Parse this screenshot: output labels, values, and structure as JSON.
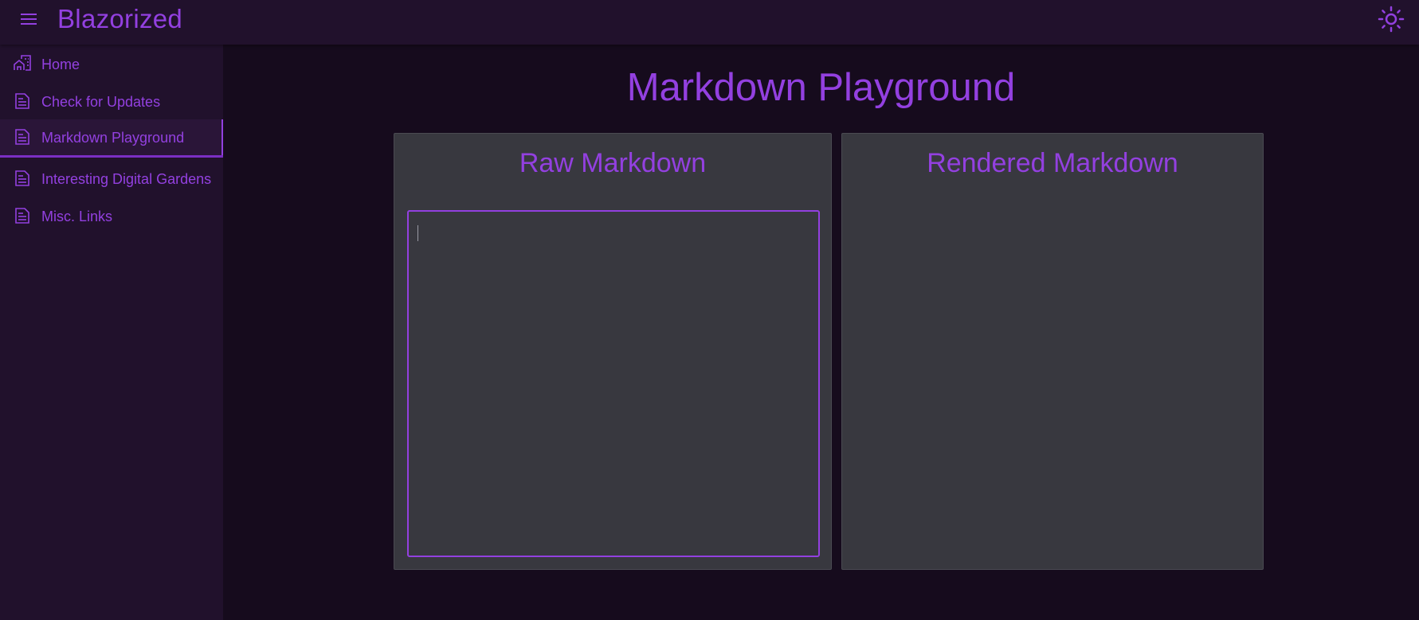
{
  "appbar": {
    "title": "Blazorized",
    "menu_icon": "hamburger-menu-icon",
    "theme_icon": "sun-icon"
  },
  "sidebar": {
    "items": [
      {
        "label": "Home",
        "icon": "home-icon",
        "active": false
      },
      {
        "label": "Check for Updates",
        "icon": "document-icon",
        "active": false
      },
      {
        "label": "Markdown Playground",
        "icon": "document-icon",
        "active": true
      },
      {
        "label": "Interesting Digital Gardens",
        "icon": "document-icon",
        "active": false
      },
      {
        "label": "Misc. Links",
        "icon": "document-icon",
        "active": false
      }
    ]
  },
  "main": {
    "title": "Markdown Playground",
    "raw_panel": {
      "title": "Raw Markdown",
      "editor_value": ""
    },
    "rendered_panel": {
      "title": "Rendered Markdown",
      "content": ""
    }
  },
  "colors": {
    "accent": "#9340e0",
    "background": "#160b1d",
    "appbar": "#21112c",
    "panel": "#38383f"
  }
}
